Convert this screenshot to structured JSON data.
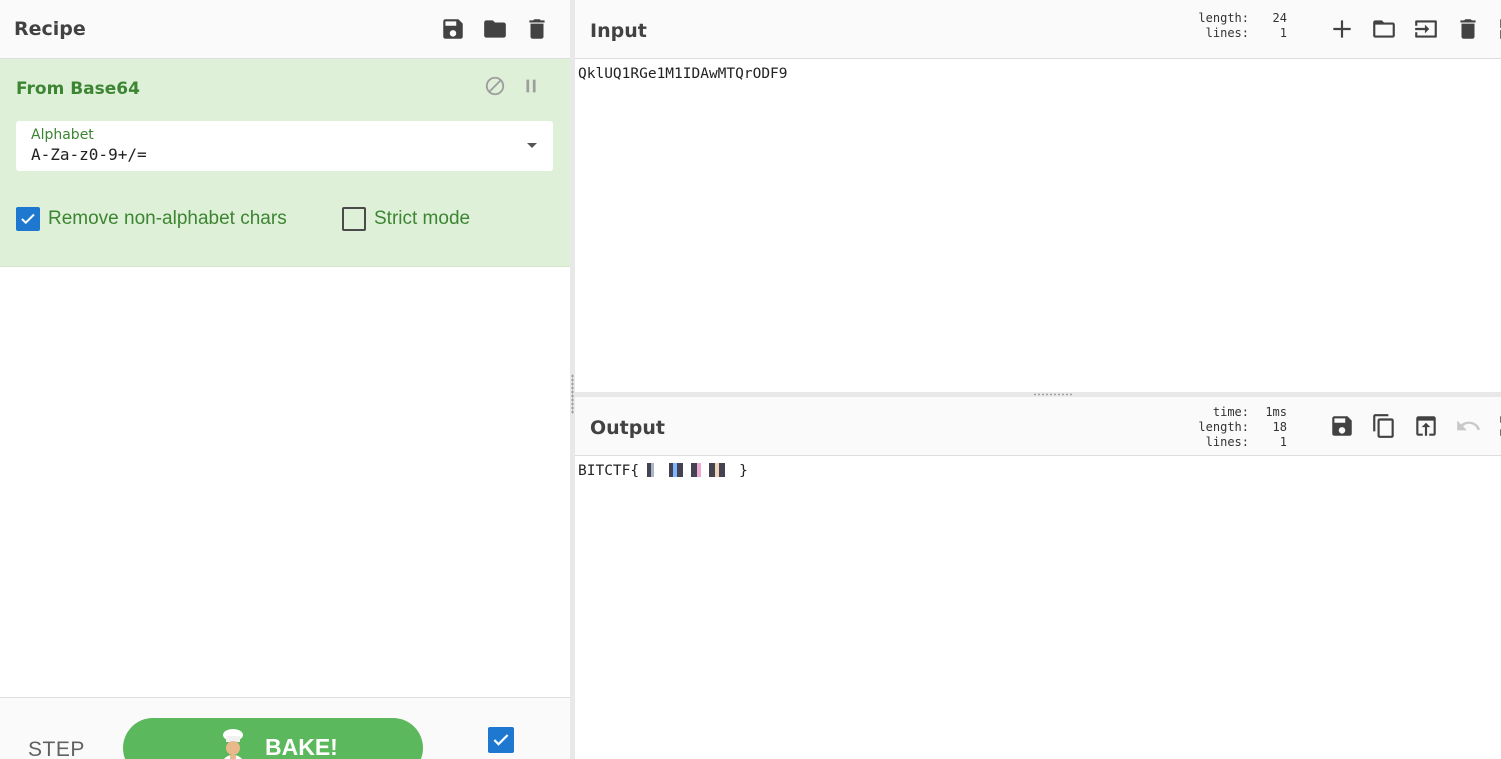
{
  "recipe": {
    "title": "Recipe",
    "header_icons": [
      "save-icon",
      "folder-icon",
      "trash-icon"
    ],
    "operation": {
      "title": "From Base64",
      "controls": [
        "disable-icon",
        "pause-icon"
      ],
      "alphabet_label": "Alphabet",
      "alphabet_value": "A-Za-z0-9+/=",
      "remove_non_alphabet_label": "Remove non-alphabet chars",
      "remove_non_alphabet_checked": true,
      "strict_mode_label": "Strict mode",
      "strict_mode_checked": false
    },
    "footer": {
      "step_label": "STEP",
      "bake_label": "BAKE!",
      "auto_bake_checked": true
    }
  },
  "input": {
    "title": "Input",
    "stats": [
      {
        "key": "length:",
        "value": "24"
      },
      {
        "key": "lines:",
        "value": "1"
      }
    ],
    "icons": [
      "plus-icon",
      "folder-icon",
      "import-icon",
      "trash-icon",
      "layout-icon"
    ],
    "text": "QklUQ1RGe1M1IDAwMTQrODF9"
  },
  "output": {
    "title": "Output",
    "stats": [
      {
        "key": "time:",
        "value": "1ms"
      },
      {
        "key": "length:",
        "value": "18"
      },
      {
        "key": "lines:",
        "value": "1"
      }
    ],
    "icons": [
      "save-icon",
      "copy-icon",
      "replace-input-icon",
      "undo-icon",
      "maximize-icon"
    ],
    "text_prefix": "BITCTF{",
    "text_suffix": "}"
  },
  "colors": {
    "operation_bg": "#dff0d8",
    "operation_text": "#3c8532",
    "bake_button": "#5cb85c",
    "checkbox_checked": "#1e78d0"
  }
}
